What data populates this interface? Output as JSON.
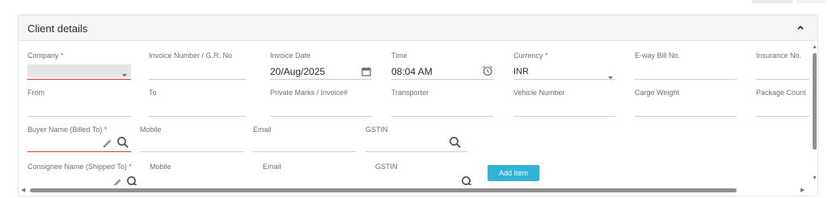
{
  "card": {
    "title": "Client details"
  },
  "row1": {
    "company_label": "Company *",
    "invoice_number_label": "Invoice Number / G.R. No",
    "invoice_date_label": "Invoice Date",
    "invoice_date_value": "20/Aug/2025",
    "time_label": "Time",
    "time_value": "08:04 AM",
    "currency_label": "Currency *",
    "currency_value": "INR",
    "eway_label": "E-way Bill No.",
    "insurance_label": "Insurance No."
  },
  "row2": {
    "from_label": "From",
    "to_label": "To",
    "private_marks_label": "Private Marks / Invoice#",
    "transporter_label": "Transporter",
    "vehicle_label": "Vehicle Number",
    "cargo_label": "Cargo Weight",
    "package_label": "Package Count"
  },
  "row3": {
    "buyer_label": "Buyer Name (Billed To) *",
    "mobile_label": "Mobile",
    "email_label": "Email",
    "gstin_label": "GSTIN"
  },
  "row4": {
    "consignee_label": "Consignee Name (Shipped To) *",
    "mobile_label": "Mobile",
    "email_label": "Email",
    "gstin_label": "GSTIN",
    "add_item_label": "Add Item"
  },
  "colors": {
    "accent": "#2fb3d6",
    "error": "#d63a3a",
    "header_bg": "#f5f5f5"
  }
}
